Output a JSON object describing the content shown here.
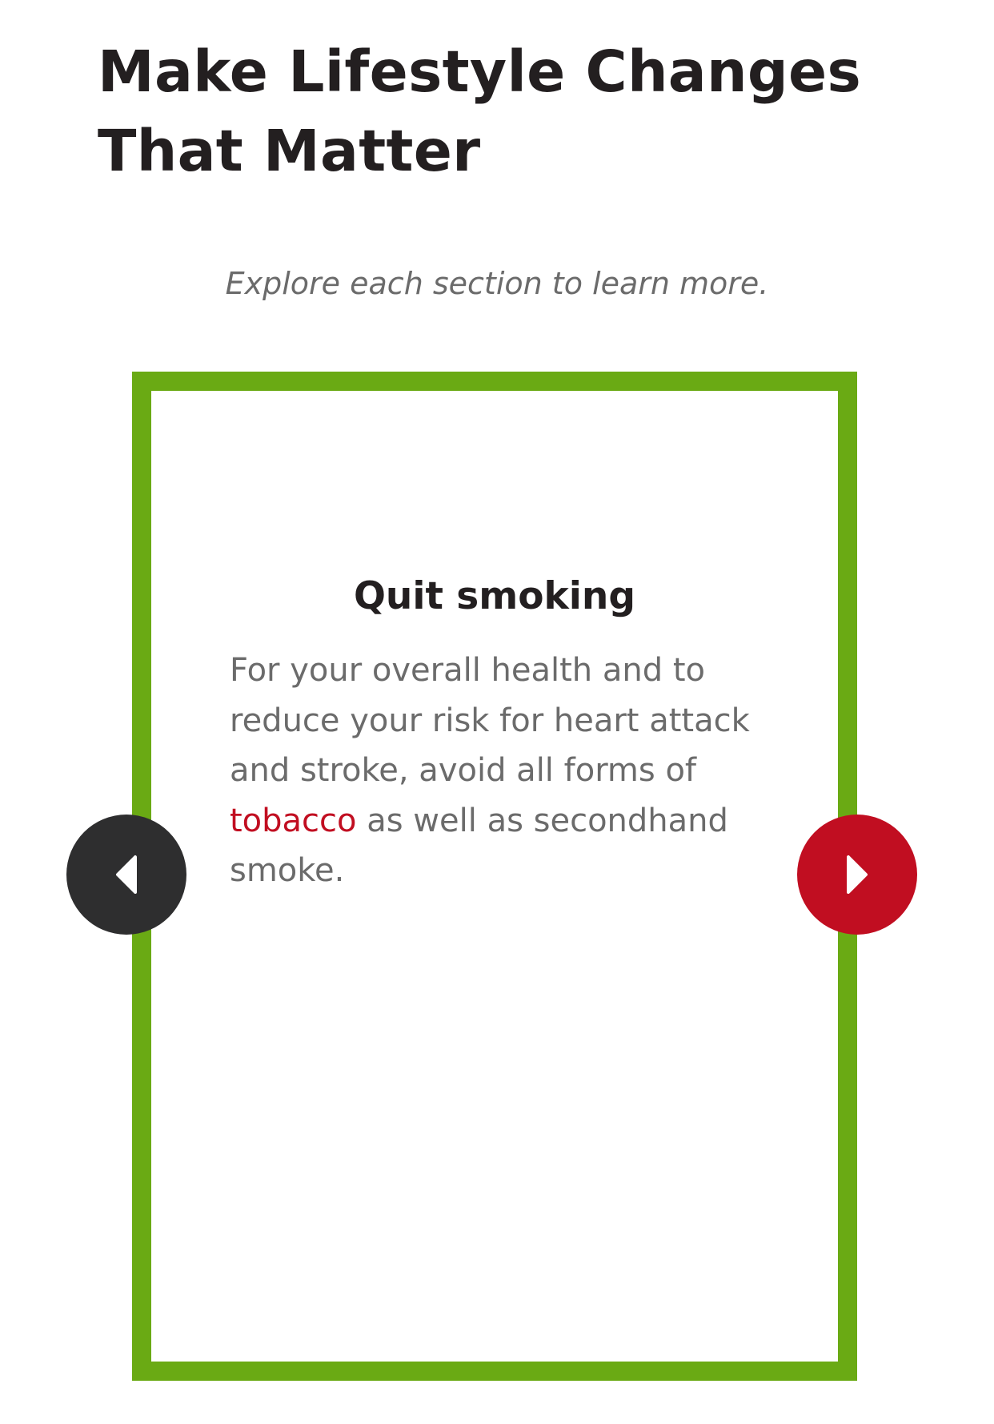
{
  "page": {
    "heading": "Make Lifestyle Changes That Matter",
    "subtitle": "Explore each section to learn more."
  },
  "carousel": {
    "active_card": {
      "title": "Quit smoking",
      "body_before": "For your overall health and to reduce your risk for heart attack and stroke, avoid all forms of ",
      "link_text": "tobacco",
      "body_after": " as well as secondhand smoke.",
      "border_color": "#6aaa14"
    },
    "prev_button": {
      "icon": "caret-left-icon",
      "color": "#2e2e2f"
    },
    "next_button": {
      "icon": "caret-right-icon",
      "color": "#c10e21"
    }
  },
  "colors": {
    "heading": "#231f20",
    "body_text": "#6b6b6b",
    "link": "#c10e21"
  }
}
